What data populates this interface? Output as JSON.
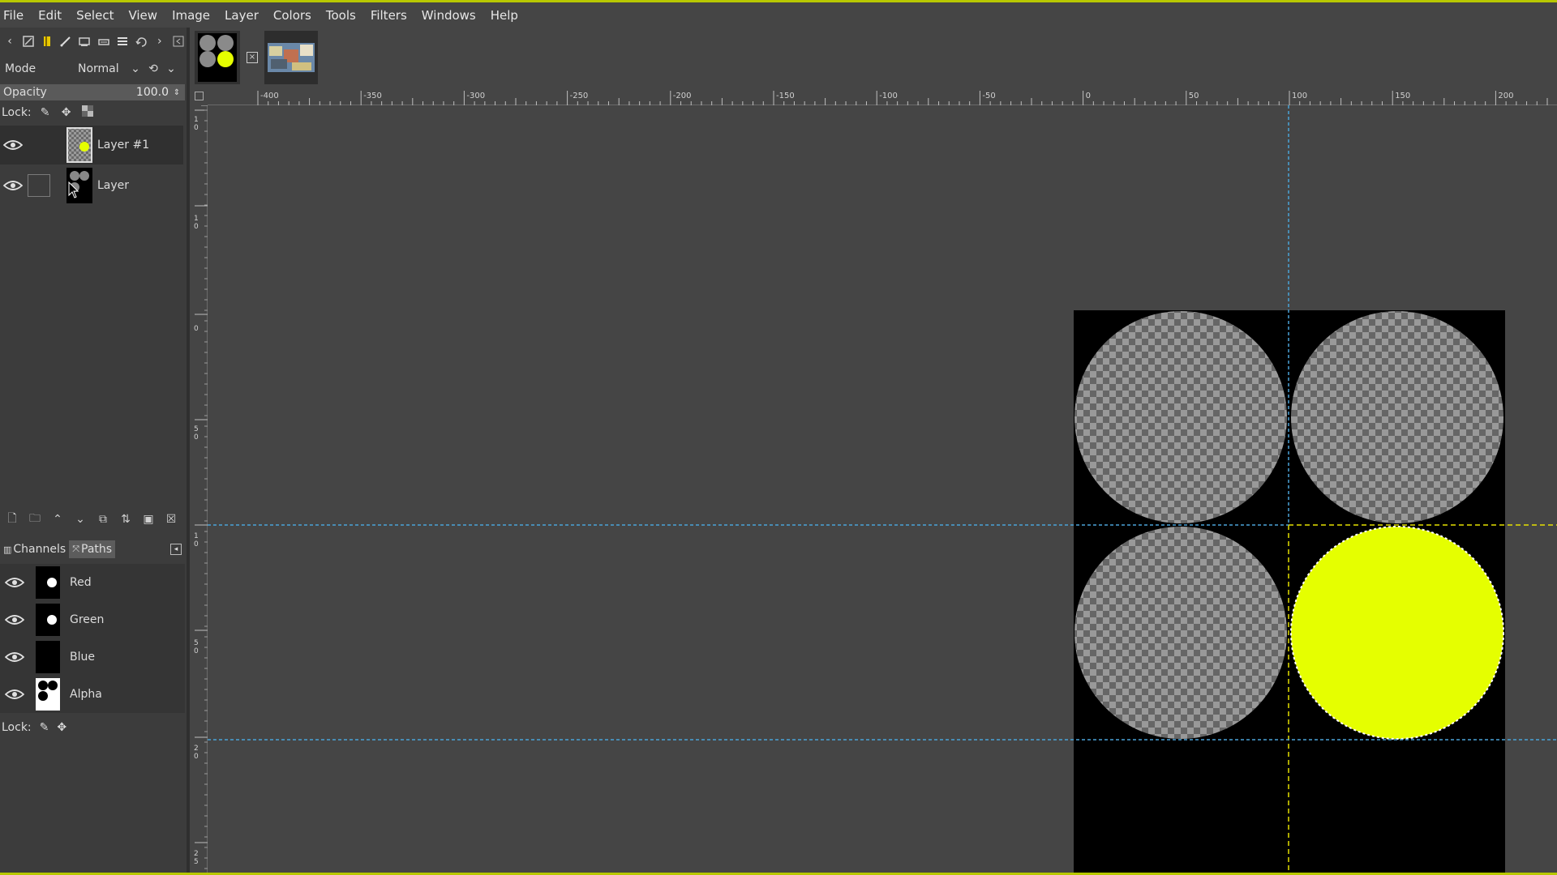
{
  "menu": [
    "File",
    "Edit",
    "Select",
    "View",
    "Image",
    "Layer",
    "Colors",
    "Tools",
    "Filters",
    "Windows",
    "Help"
  ],
  "layers_panel": {
    "mode_label": "Mode",
    "mode_value": "Normal",
    "opacity_label": "Opacity",
    "opacity_value": "100.0",
    "lock_label": "Lock:",
    "layers": [
      {
        "name": "Layer #1",
        "visible": true,
        "selected": true
      },
      {
        "name": "Layer",
        "visible": true,
        "selected": false
      }
    ]
  },
  "dock_tabs": {
    "channels": "Channels",
    "paths": "Paths"
  },
  "channels": [
    {
      "name": "Red"
    },
    {
      "name": "Green"
    },
    {
      "name": "Blue"
    },
    {
      "name": "Alpha"
    }
  ],
  "channels_lock_label": "Lock:",
  "ruler": {
    "top_ticks": [
      "-400",
      "-350",
      "-300",
      "-250",
      "-200",
      "-150",
      "-100",
      "-50",
      "0",
      "50",
      "100",
      "150",
      "200"
    ]
  },
  "colors": {
    "accent_yellow": "#e5ff00",
    "guide_blue": "#4aa3d8",
    "canvas_bg": "#000000",
    "frame": "#b8c800"
  }
}
